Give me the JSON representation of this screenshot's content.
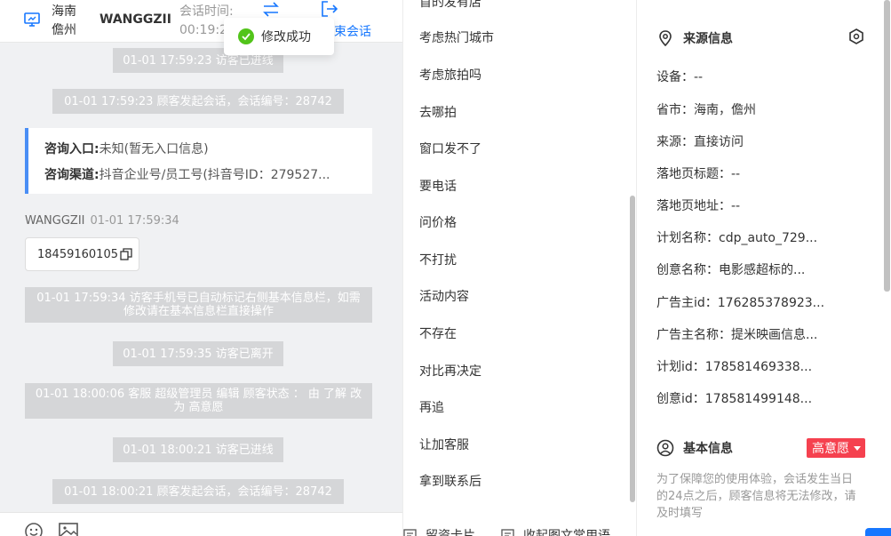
{
  "header": {
    "province": "海南",
    "city": "儋州",
    "visitor_name": "WANGGZII",
    "session_label": "会话时间:",
    "session_time": "00:19:2",
    "end_label": "束会话"
  },
  "toast": {
    "text": "修改成功"
  },
  "chat": {
    "sys_messages": [
      "01-01 17:59:23 访客已进线",
      "01-01 17:59:23 顾客发起会话，会话编号：28742",
      "01-01 17:59:34 访客手机号已自动标记右侧基本信息栏，如需修改请在基本信息栏直接操作",
      "01-01 17:59:35 访客已离开",
      "01-01 18:00:06 客服 超级管理员 编辑 顾客状态 ： 由 了解 改为 高意愿",
      "01-01 18:00:21 访客已进线",
      "01-01 18:00:21 顾客发起会话，会话编号：28742"
    ],
    "info_card": {
      "entry_key": "咨询入口:",
      "entry_val": "未知(暂无入口信息)",
      "channel_key": "咨询渠道:",
      "channel_val": "抖音企业号/员工号(抖音号ID：279527..."
    },
    "message": {
      "author": "WANGGZII",
      "time": "01-01 17:59:34",
      "text": "18459160105"
    }
  },
  "quick_replies": {
    "items": [
      "首的发有店",
      "考虑热门城市",
      "考虑旅拍吗",
      "去哪拍",
      "窗口发不了",
      "要电话",
      "问价格",
      "不打扰",
      "活动内容",
      "不存在",
      "对比再决定",
      "再追",
      "让加客服",
      "拿到联系后"
    ],
    "footer": [
      "留资卡片",
      "收起图文常用语"
    ]
  },
  "source_info": {
    "title": "来源信息",
    "fields": [
      "设备：--",
      "省市：海南，儋州",
      "来源：直接访问",
      "落地页标题：--",
      "落地页地址：--",
      "计划名称：cdp_auto_729...",
      "创意名称：电影感超标的...",
      "广告主id：176285378923...",
      "广告主名称：提米映画信息...",
      "计划id：178581469338...",
      "创意id：178581499148..."
    ]
  },
  "basic_info": {
    "title": "基本信息",
    "intent_badge": "高意愿",
    "notice": "为了保障您的使用体验，会话发生当日的24点之后，顾客信息将无法修改，请及时填写"
  },
  "colors": {
    "accent": "#1677ff",
    "badge": "#f5414f",
    "success": "#52c41a",
    "card_border": "#4a8ef5"
  }
}
